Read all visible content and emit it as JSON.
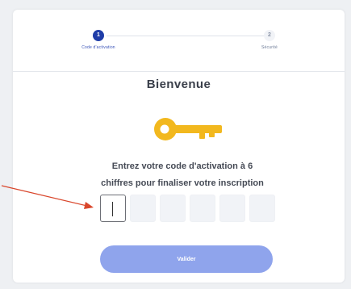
{
  "stepper": {
    "steps": [
      {
        "number": "1",
        "label": "Code d'activation",
        "state": "active"
      },
      {
        "number": "2",
        "label": "Sécurité",
        "state": "inactive"
      }
    ]
  },
  "title": "Bienvenue",
  "instruction": {
    "line1": "Entrez votre code d'activation à 6",
    "line2": "chiffres pour finaliser votre inscription"
  },
  "code_input": {
    "length": 6,
    "values": [
      "",
      "",
      "",
      "",
      "",
      ""
    ]
  },
  "submit_button": {
    "label": "Valider"
  },
  "colors": {
    "primary": "#1f3da8",
    "button": "#8fa4ec",
    "key": "#f2b81e",
    "arrow": "#d9462b",
    "input_bg": "#f1f3f7"
  },
  "icons": {
    "key": "key-icon",
    "annotation": "red-arrow"
  }
}
